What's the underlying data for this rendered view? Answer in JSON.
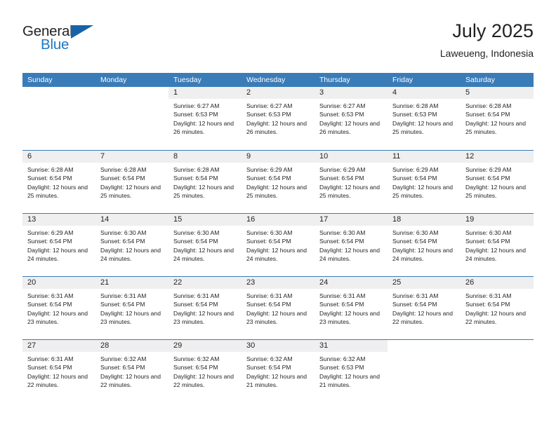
{
  "brand": {
    "name_top": "General",
    "name_bottom": "Blue",
    "triangle_icon": "brand-triangle-icon",
    "accent_color": "#1f78c1",
    "header_color": "#3a7cb8"
  },
  "header": {
    "title": "July 2025",
    "subtitle": "Laweueng, Indonesia"
  },
  "weekdays": [
    "Sunday",
    "Monday",
    "Tuesday",
    "Wednesday",
    "Thursday",
    "Friday",
    "Saturday"
  ],
  "weeks": [
    [
      {
        "day": "",
        "lines": []
      },
      {
        "day": "",
        "lines": []
      },
      {
        "day": "1",
        "lines": [
          "Sunrise: 6:27 AM",
          "Sunset: 6:53 PM",
          "Daylight: 12 hours and 26 minutes."
        ]
      },
      {
        "day": "2",
        "lines": [
          "Sunrise: 6:27 AM",
          "Sunset: 6:53 PM",
          "Daylight: 12 hours and 26 minutes."
        ]
      },
      {
        "day": "3",
        "lines": [
          "Sunrise: 6:27 AM",
          "Sunset: 6:53 PM",
          "Daylight: 12 hours and 26 minutes."
        ]
      },
      {
        "day": "4",
        "lines": [
          "Sunrise: 6:28 AM",
          "Sunset: 6:53 PM",
          "Daylight: 12 hours and 25 minutes."
        ]
      },
      {
        "day": "5",
        "lines": [
          "Sunrise: 6:28 AM",
          "Sunset: 6:54 PM",
          "Daylight: 12 hours and 25 minutes."
        ]
      }
    ],
    [
      {
        "day": "6",
        "lines": [
          "Sunrise: 6:28 AM",
          "Sunset: 6:54 PM",
          "Daylight: 12 hours and 25 minutes."
        ]
      },
      {
        "day": "7",
        "lines": [
          "Sunrise: 6:28 AM",
          "Sunset: 6:54 PM",
          "Daylight: 12 hours and 25 minutes."
        ]
      },
      {
        "day": "8",
        "lines": [
          "Sunrise: 6:28 AM",
          "Sunset: 6:54 PM",
          "Daylight: 12 hours and 25 minutes."
        ]
      },
      {
        "day": "9",
        "lines": [
          "Sunrise: 6:29 AM",
          "Sunset: 6:54 PM",
          "Daylight: 12 hours and 25 minutes."
        ]
      },
      {
        "day": "10",
        "lines": [
          "Sunrise: 6:29 AM",
          "Sunset: 6:54 PM",
          "Daylight: 12 hours and 25 minutes."
        ]
      },
      {
        "day": "11",
        "lines": [
          "Sunrise: 6:29 AM",
          "Sunset: 6:54 PM",
          "Daylight: 12 hours and 25 minutes."
        ]
      },
      {
        "day": "12",
        "lines": [
          "Sunrise: 6:29 AM",
          "Sunset: 6:54 PM",
          "Daylight: 12 hours and 25 minutes."
        ]
      }
    ],
    [
      {
        "day": "13",
        "lines": [
          "Sunrise: 6:29 AM",
          "Sunset: 6:54 PM",
          "Daylight: 12 hours and 24 minutes."
        ]
      },
      {
        "day": "14",
        "lines": [
          "Sunrise: 6:30 AM",
          "Sunset: 6:54 PM",
          "Daylight: 12 hours and 24 minutes."
        ]
      },
      {
        "day": "15",
        "lines": [
          "Sunrise: 6:30 AM",
          "Sunset: 6:54 PM",
          "Daylight: 12 hours and 24 minutes."
        ]
      },
      {
        "day": "16",
        "lines": [
          "Sunrise: 6:30 AM",
          "Sunset: 6:54 PM",
          "Daylight: 12 hours and 24 minutes."
        ]
      },
      {
        "day": "17",
        "lines": [
          "Sunrise: 6:30 AM",
          "Sunset: 6:54 PM",
          "Daylight: 12 hours and 24 minutes."
        ]
      },
      {
        "day": "18",
        "lines": [
          "Sunrise: 6:30 AM",
          "Sunset: 6:54 PM",
          "Daylight: 12 hours and 24 minutes."
        ]
      },
      {
        "day": "19",
        "lines": [
          "Sunrise: 6:30 AM",
          "Sunset: 6:54 PM",
          "Daylight: 12 hours and 24 minutes."
        ]
      }
    ],
    [
      {
        "day": "20",
        "lines": [
          "Sunrise: 6:31 AM",
          "Sunset: 6:54 PM",
          "Daylight: 12 hours and 23 minutes."
        ]
      },
      {
        "day": "21",
        "lines": [
          "Sunrise: 6:31 AM",
          "Sunset: 6:54 PM",
          "Daylight: 12 hours and 23 minutes."
        ]
      },
      {
        "day": "22",
        "lines": [
          "Sunrise: 6:31 AM",
          "Sunset: 6:54 PM",
          "Daylight: 12 hours and 23 minutes."
        ]
      },
      {
        "day": "23",
        "lines": [
          "Sunrise: 6:31 AM",
          "Sunset: 6:54 PM",
          "Daylight: 12 hours and 23 minutes."
        ]
      },
      {
        "day": "24",
        "lines": [
          "Sunrise: 6:31 AM",
          "Sunset: 6:54 PM",
          "Daylight: 12 hours and 23 minutes."
        ]
      },
      {
        "day": "25",
        "lines": [
          "Sunrise: 6:31 AM",
          "Sunset: 6:54 PM",
          "Daylight: 12 hours and 22 minutes."
        ]
      },
      {
        "day": "26",
        "lines": [
          "Sunrise: 6:31 AM",
          "Sunset: 6:54 PM",
          "Daylight: 12 hours and 22 minutes."
        ]
      }
    ],
    [
      {
        "day": "27",
        "lines": [
          "Sunrise: 6:31 AM",
          "Sunset: 6:54 PM",
          "Daylight: 12 hours and 22 minutes."
        ]
      },
      {
        "day": "28",
        "lines": [
          "Sunrise: 6:32 AM",
          "Sunset: 6:54 PM",
          "Daylight: 12 hours and 22 minutes."
        ]
      },
      {
        "day": "29",
        "lines": [
          "Sunrise: 6:32 AM",
          "Sunset: 6:54 PM",
          "Daylight: 12 hours and 22 minutes."
        ]
      },
      {
        "day": "30",
        "lines": [
          "Sunrise: 6:32 AM",
          "Sunset: 6:54 PM",
          "Daylight: 12 hours and 21 minutes."
        ]
      },
      {
        "day": "31",
        "lines": [
          "Sunrise: 6:32 AM",
          "Sunset: 6:53 PM",
          "Daylight: 12 hours and 21 minutes."
        ]
      },
      {
        "day": "",
        "lines": []
      },
      {
        "day": "",
        "lines": []
      }
    ]
  ]
}
